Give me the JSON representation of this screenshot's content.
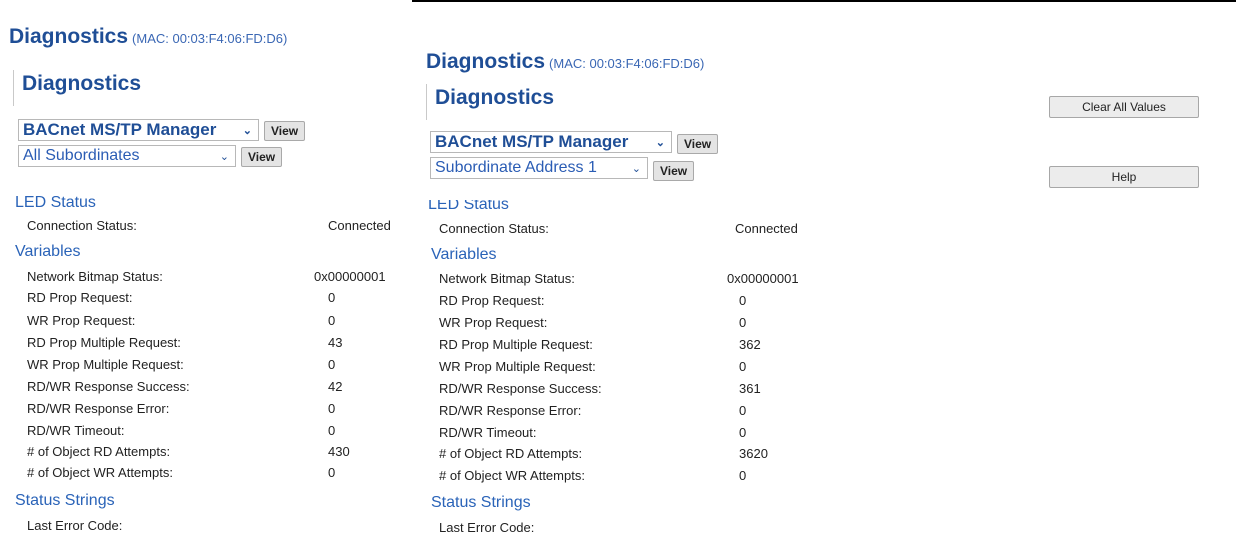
{
  "left": {
    "heading": "Diagnostics",
    "mac": "(MAC: 00:03:F4:06:FD:D6)",
    "subheading": "Diagnostics",
    "manager_select": "BACnet MS/TP Manager",
    "manager_view": "View",
    "subordinate_select": "All Subordinates",
    "subordinate_view": "View",
    "led_status": "LED Status",
    "connection_label": "Connection Status:",
    "connection_value": "Connected",
    "variables": "Variables",
    "rows": [
      {
        "label": "Network Bitmap Status:",
        "value": "0x00000001"
      },
      {
        "label": "RD Prop Request:",
        "value": "0"
      },
      {
        "label": "WR Prop Request:",
        "value": "0"
      },
      {
        "label": "RD Prop Multiple Request:",
        "value": "43"
      },
      {
        "label": "WR Prop Multiple Request:",
        "value": "0"
      },
      {
        "label": "RD/WR Response Success:",
        "value": "42"
      },
      {
        "label": "RD/WR Response Error:",
        "value": "0"
      },
      {
        "label": "RD/WR Timeout:",
        "value": "0"
      },
      {
        "label": "# of Object RD Attempts:",
        "value": "430"
      },
      {
        "label": "# of Object WR Attempts:",
        "value": "0"
      }
    ],
    "status_strings": "Status Strings",
    "last_error_label": "Last Error Code:"
  },
  "right": {
    "heading": "Diagnostics",
    "mac": "(MAC: 00:03:F4:06:FD:D6)",
    "subheading": "Diagnostics",
    "manager_select": "BACnet MS/TP Manager",
    "manager_view": "View",
    "subordinate_select": "Subordinate Address 1",
    "subordinate_view": "View",
    "led_status": "LED Status",
    "connection_label": "Connection Status:",
    "connection_value": "Connected",
    "variables": "Variables",
    "rows": [
      {
        "label": "Network Bitmap Status:",
        "value": "0x00000001"
      },
      {
        "label": "RD Prop Request:",
        "value": "0"
      },
      {
        "label": "WR Prop Request:",
        "value": "0"
      },
      {
        "label": "RD Prop Multiple Request:",
        "value": "362"
      },
      {
        "label": "WR Prop Multiple Request:",
        "value": "0"
      },
      {
        "label": "RD/WR Response Success:",
        "value": "361"
      },
      {
        "label": "RD/WR Response Error:",
        "value": "0"
      },
      {
        "label": "RD/WR Timeout:",
        "value": "0"
      },
      {
        "label": "# of Object RD Attempts:",
        "value": "3620"
      },
      {
        "label": "# of Object WR Attempts:",
        "value": "0"
      }
    ],
    "status_strings": "Status Strings",
    "last_error_label": "Last Error Code:",
    "clear_all": "Clear All Values",
    "help": "Help"
  },
  "colors": {
    "heading": "#1f4e96",
    "section": "#2a63b8",
    "text": "#222222"
  }
}
